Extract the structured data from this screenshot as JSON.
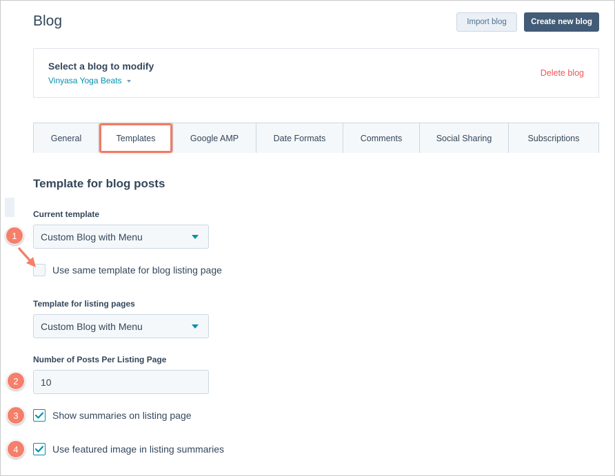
{
  "header": {
    "title": "Blog",
    "import_label": "Import blog",
    "create_label": "Create new blog"
  },
  "blog_selector": {
    "heading": "Select a blog to modify",
    "selected_blog": "Vinyasa Yoga Beats",
    "delete_label": "Delete blog"
  },
  "tabs": [
    {
      "label": "General"
    },
    {
      "label": "Templates",
      "active": true
    },
    {
      "label": "Google AMP"
    },
    {
      "label": "Date Formats"
    },
    {
      "label": "Comments"
    },
    {
      "label": "Social Sharing"
    },
    {
      "label": "Subscriptions"
    }
  ],
  "main": {
    "section_title": "Template for blog posts",
    "current_template": {
      "label": "Current template",
      "value": "Custom Blog with Menu"
    },
    "same_template": {
      "label": "Use same template for blog listing page",
      "checked": false
    },
    "listing_template": {
      "label": "Template for listing pages",
      "value": "Custom Blog with Menu"
    },
    "posts_per_page": {
      "label": "Number of Posts Per Listing Page",
      "value": "10"
    },
    "show_summaries": {
      "label": "Show summaries on listing page",
      "checked": true
    },
    "featured_image": {
      "label": "Use featured image in listing summaries",
      "checked": true
    }
  },
  "callouts": [
    "1",
    "2",
    "3",
    "4"
  ],
  "colors": {
    "accent": "#0091ae",
    "primary_button": "#425b76",
    "danger": "#f2545b",
    "callout": "#f57f6b"
  }
}
